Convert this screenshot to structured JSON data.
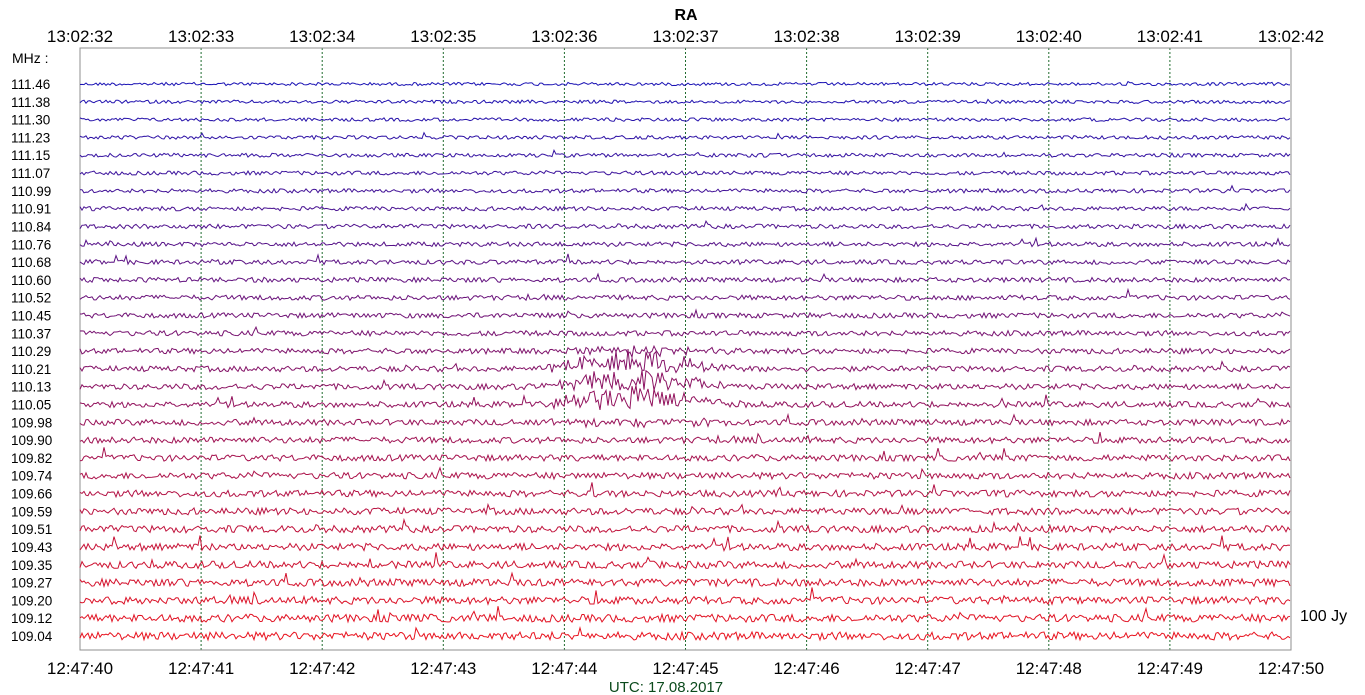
{
  "chart_data": {
    "type": "line",
    "title": "RA",
    "unit_label": "MHz :",
    "scale_label": "100 Jy",
    "date_label": "UTC: 17.08.2017",
    "top_axis_ticks": [
      "13:02:32",
      "13:02:33",
      "13:02:34",
      "13:02:35",
      "13:02:36",
      "13:02:37",
      "13:02:38",
      "13:02:39",
      "13:02:40",
      "13:02:41",
      "13:02:42"
    ],
    "bottom_axis_ticks": [
      "12:47:40",
      "12:47:41",
      "12:47:42",
      "12:47:43",
      "12:47:44",
      "12:47:45",
      "12:47:46",
      "12:47:47",
      "12:47:48",
      "12:47:49",
      "12:47:50"
    ],
    "xlim_seconds": [
      0,
      10
    ],
    "grid": "vertical dotted at each second",
    "channels": [
      "111.46",
      "111.38",
      "111.30",
      "111.23",
      "111.15",
      "111.07",
      "110.99",
      "110.91",
      "110.84",
      "110.76",
      "110.68",
      "110.60",
      "110.52",
      "110.45",
      "110.37",
      "110.29",
      "110.21",
      "110.13",
      "110.05",
      "109.98",
      "109.90",
      "109.82",
      "109.74",
      "109.66",
      "109.59",
      "109.51",
      "109.43",
      "109.35",
      "109.27",
      "109.20",
      "109.12",
      "109.04"
    ],
    "series_colors": {
      "top": "#1a12b4",
      "bottom": "#e8121e"
    },
    "grid_color": "#1f6b2e",
    "feature": {
      "description_note": "burst centered ~12:47:44.6, strongest on 110.05-110.13 MHz",
      "center_seconds": 4.6,
      "width_seconds": 0.9,
      "peak_channel_indices": [
        16,
        17,
        18
      ]
    }
  }
}
